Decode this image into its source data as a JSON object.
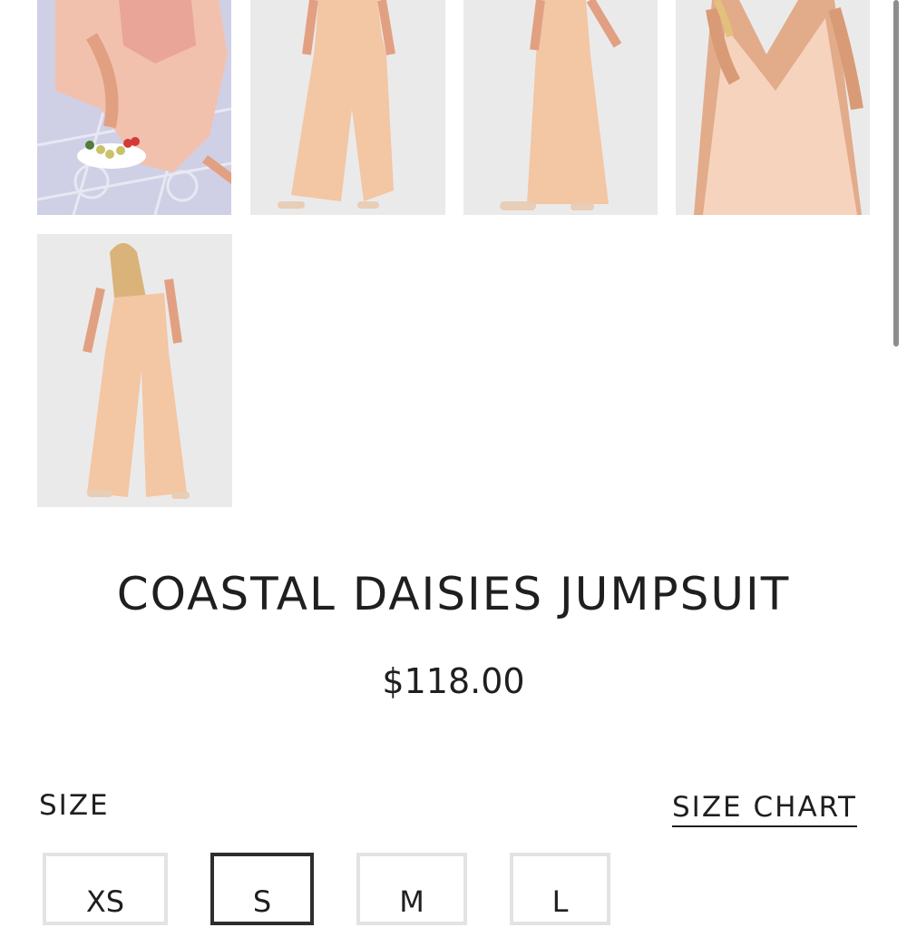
{
  "product": {
    "title": "COASTAL DAISIES JUMPSUIT",
    "price": "$118.00"
  },
  "gallery": {
    "thumbnails": [
      {
        "name": "lifestyle-seated-photo"
      },
      {
        "name": "front-full-length-photo"
      },
      {
        "name": "side-full-length-photo"
      },
      {
        "name": "bodice-closeup-photo"
      },
      {
        "name": "back-full-length-photo"
      }
    ]
  },
  "size_selector": {
    "label": "SIZE",
    "chart_link": "SIZE CHART",
    "options": [
      "XS",
      "S",
      "M",
      "L"
    ],
    "selected": "S"
  },
  "colors": {
    "fabric": "#f3c6a4",
    "print": "#e9948a",
    "background": "#ebeaea",
    "tile": "#cfd0e6"
  }
}
